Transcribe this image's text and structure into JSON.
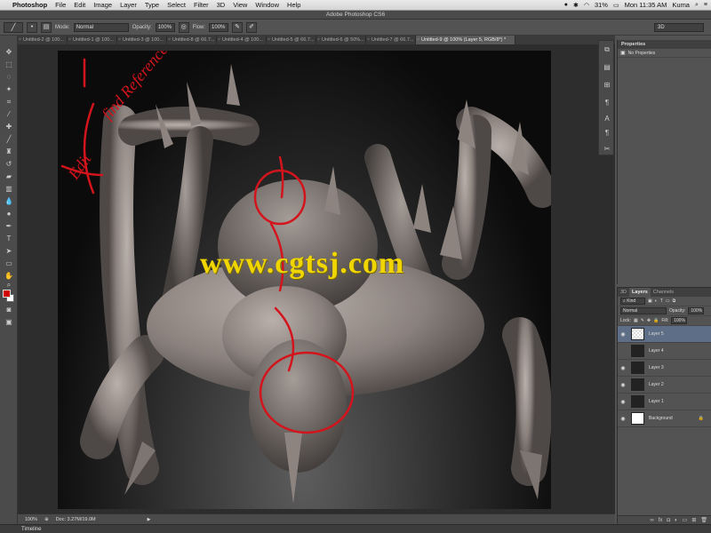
{
  "menubar": {
    "app_name": "Photoshop",
    "items": [
      "File",
      "Edit",
      "Image",
      "Layer",
      "Type",
      "Select",
      "Filter",
      "3D",
      "View",
      "Window",
      "Help"
    ],
    "battery": "31%",
    "clock": "Mon 11:35 AM",
    "user": "Kuma"
  },
  "window": {
    "title": "Adobe Photoshop CS6"
  },
  "options": {
    "mode_label": "Mode:",
    "mode_value": "Normal",
    "opacity_label": "Opacity:",
    "opacity_value": "100%",
    "flow_label": "Flow:",
    "flow_value": "100%",
    "workspace": "3D"
  },
  "tabs": [
    "Untitled-2 @ 100...",
    "Untitled-1 @ 100...",
    "Untitled-3 @ 100...",
    "Untitled-8 @ 66.7...",
    "Untitled-4 @ 100...",
    "Untitled-5 @ 66.7...",
    "Untitled-6 @ 50%...",
    "Untitled-7 @ 66.7...",
    "Untitled-9 @ 100% (Layer 5, RGB/8*) *"
  ],
  "canvas": {
    "annotation_lines": [
      "find Reference",
      "Edit"
    ],
    "watermark": "www.cgtsj.com"
  },
  "status": {
    "zoom": "100%",
    "doc": "Doc: 3.27M/19.0M",
    "timeline": "Timeline"
  },
  "properties": {
    "title": "Properties",
    "message": "No Properties"
  },
  "layers_panel": {
    "tabs": [
      "3D",
      "Layers",
      "Channels"
    ],
    "kind_label": "Kind",
    "blend_mode": "Normal",
    "opacity_label": "Opacity:",
    "opacity_value": "100%",
    "lock_label": "Lock:",
    "fill_label": "Fill:",
    "fill_value": "100%",
    "layers": [
      "Layer 5",
      "Layer 4",
      "Layer 3",
      "Layer 2",
      "Layer 1",
      "Background"
    ]
  },
  "colors": {
    "foreground": "#d10000",
    "background": "#ffffff",
    "annotation": "#d4141c",
    "watermark": "#f0d500",
    "selected_layer": "#5d6e86"
  }
}
